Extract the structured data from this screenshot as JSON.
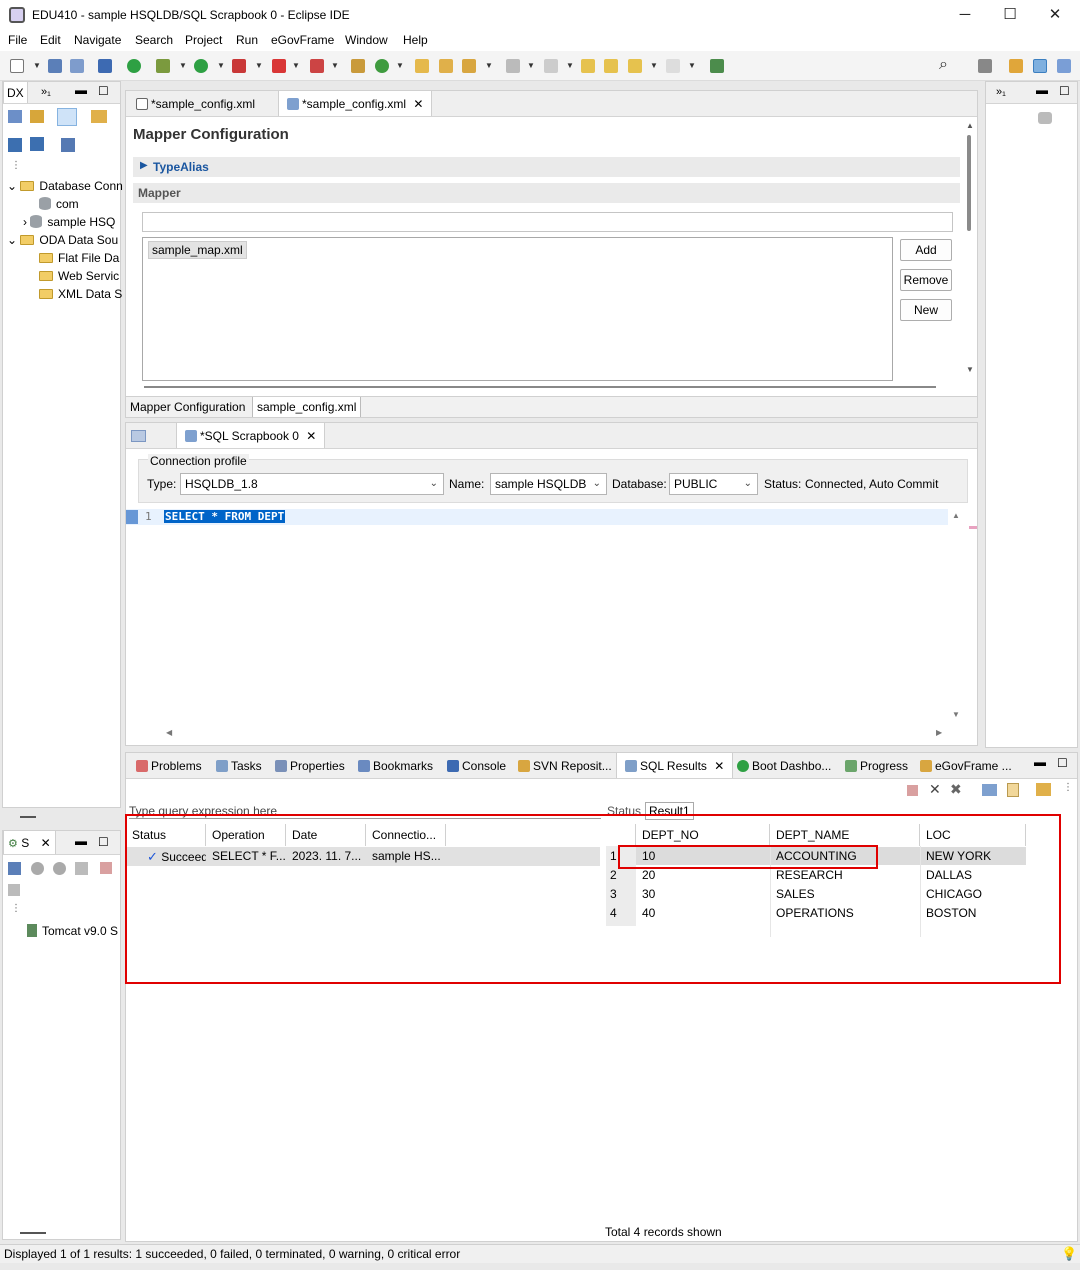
{
  "window": {
    "title": "EDU410 - sample HSQLDB/SQL Scrapbook 0 - Eclipse IDE",
    "minimize": "─",
    "maximize": "☐",
    "close": "✕"
  },
  "menu": [
    "File",
    "Edit",
    "Navigate",
    "Search",
    "Project",
    "Run",
    "eGovFrame",
    "Window",
    "Help"
  ],
  "left_panel": {
    "tab_label": "DX",
    "tab_more": "»₁",
    "tree": [
      {
        "label": "Database Conn",
        "icon": "folder"
      },
      {
        "label": "com",
        "icon": "database"
      },
      {
        "label": "sample HSQ",
        "icon": "database"
      },
      {
        "label": "ODA Data Sou",
        "icon": "folder"
      },
      {
        "label": "Flat File Da",
        "icon": "folder"
      },
      {
        "label": "Web Servic",
        "icon": "folder"
      },
      {
        "label": "XML Data S",
        "icon": "folder"
      }
    ]
  },
  "servers_panel": {
    "tab_label": "S",
    "item": "Tomcat v9.0 S"
  },
  "editor_tabs": [
    {
      "label": "*sample_config.xml",
      "active": false
    },
    {
      "label": "*sample_config.xml",
      "active": true
    }
  ],
  "mapper": {
    "title": "Mapper Configuration",
    "typealias_label": "TypeAlias",
    "mapper_label": "Mapper",
    "mapper_items": [
      "sample_map.xml"
    ],
    "add_label": "Add",
    "remove_label": "Remove",
    "new_label": "New",
    "bottom_tabs": [
      "Mapper Configuration",
      "sample_config.xml"
    ]
  },
  "scrapbook": {
    "tab_label": "*SQL Scrapbook 0",
    "connection_profile_label": "Connection profile",
    "type_label": "Type:",
    "type_value": "HSQLDB_1.8",
    "name_label": "Name:",
    "name_value": "sample HSQLDB",
    "database_label": "Database:",
    "database_value": "PUBLIC",
    "status_label": "Status:",
    "status_value": "Connected, Auto Commit",
    "line_number": "1",
    "sql": "SELECT * FROM DEPT"
  },
  "bottom_tabs": [
    "Problems",
    "Tasks",
    "Properties",
    "Bookmarks",
    "Console",
    "SVN Reposit...",
    "SQL Results",
    "Boot Dashbo...",
    "Progress",
    "eGovFrame ..."
  ],
  "sql_results": {
    "filter_placeholder": "Type query expression here",
    "history_columns": [
      "Status",
      "Operation",
      "Date",
      "Connectio..."
    ],
    "history_rows": [
      [
        "Succeeded",
        "SELECT * F...",
        "2023. 11. 7...",
        "sample HS..."
      ]
    ],
    "result_tabs": [
      "Status",
      "Result1"
    ],
    "columns": [
      "DEPT_NO",
      "DEPT_NAME",
      "LOC"
    ],
    "rows": [
      {
        "n": "1",
        "dept_no": "10",
        "dept_name": "ACCOUNTING",
        "loc": "NEW YORK"
      },
      {
        "n": "2",
        "dept_no": "20",
        "dept_name": "RESEARCH",
        "loc": "DALLAS"
      },
      {
        "n": "3",
        "dept_no": "30",
        "dept_name": "SALES",
        "loc": "CHICAGO"
      },
      {
        "n": "4",
        "dept_no": "40",
        "dept_name": "OPERATIONS",
        "loc": "BOSTON"
      }
    ],
    "total": "Total 4 records shown"
  },
  "status_bar": "Displayed 1 of 1 results: 1 succeeded, 0 failed, 0 terminated, 0 warning, 0 critical error",
  "colors": {
    "highlight_red": "#e00000",
    "selection_blue": "#0064c8",
    "link_blue": "#1a56a0",
    "success_check": "#1e56d8"
  }
}
